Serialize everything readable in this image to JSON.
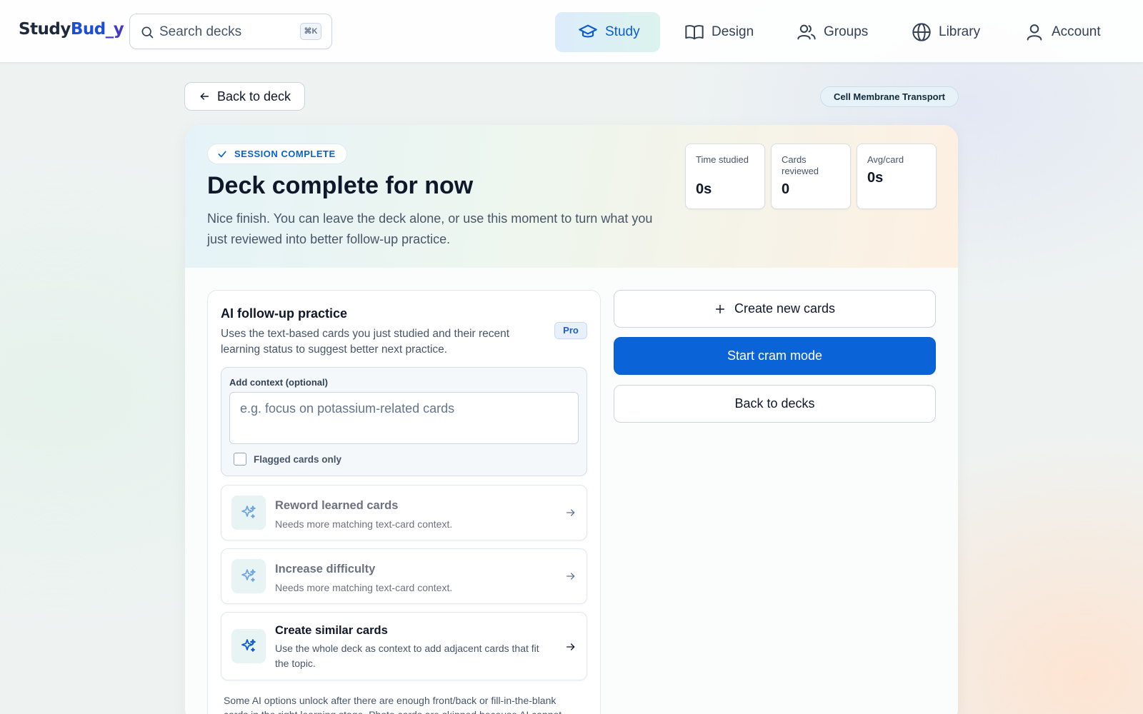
{
  "brand": {
    "part1": "Study",
    "part2": "Bud",
    "part3": "_y"
  },
  "search": {
    "placeholder": "Search decks",
    "shortcut": "⌘K"
  },
  "nav": [
    {
      "label": "Study",
      "icon": "graduation-cap-icon",
      "active": true
    },
    {
      "label": "Design",
      "icon": "book-icon",
      "active": false
    },
    {
      "label": "Groups",
      "icon": "users-icon",
      "active": false
    },
    {
      "label": "Library",
      "icon": "globe-icon",
      "active": false
    },
    {
      "label": "Account",
      "icon": "user-icon",
      "active": false
    }
  ],
  "back_to_deck": "Back to deck",
  "deck_name": "Cell Membrane Transport",
  "session": {
    "badge": "SESSION COMPLETE",
    "title": "Deck complete for now",
    "description": "Nice finish. You can leave the deck alone, or use this moment to turn what you just reviewed into better follow-up practice."
  },
  "stats": [
    {
      "label": "Time studied",
      "value": "0s"
    },
    {
      "label": "Cards reviewed",
      "value": "0"
    },
    {
      "label": "Avg/card",
      "value": "0s"
    }
  ],
  "ai_panel": {
    "title": "AI follow-up practice",
    "description": "Uses the text-based cards you just studied and their recent learning status to suggest better next practice.",
    "pro_badge": "Pro",
    "context_label": "Add context (optional)",
    "context_placeholder": "e.g. focus on potassium-related cards",
    "flagged_label": "Flagged cards only",
    "options": [
      {
        "title": "Reword learned cards",
        "description": "Needs more matching text-card context.",
        "enabled": false
      },
      {
        "title": "Increase difficulty",
        "description": "Needs more matching text-card context.",
        "enabled": false
      },
      {
        "title": "Create similar cards",
        "description": "Use the whole deck as context to add adjacent cards that fit the topic.",
        "enabled": true
      }
    ],
    "footnote": "Some AI options unlock after there are enough front/back or fill-in-the-blank cards in the right learning stage. Photo cards are skipped because AI cannot"
  },
  "actions": {
    "create_new": "Create new cards",
    "cram": "Start cram mode",
    "back_to_decks": "Back to decks"
  },
  "colors": {
    "primary": "#0a64d8",
    "accent_text": "#0b63c9",
    "brand_blue": "#1d4ed8"
  }
}
